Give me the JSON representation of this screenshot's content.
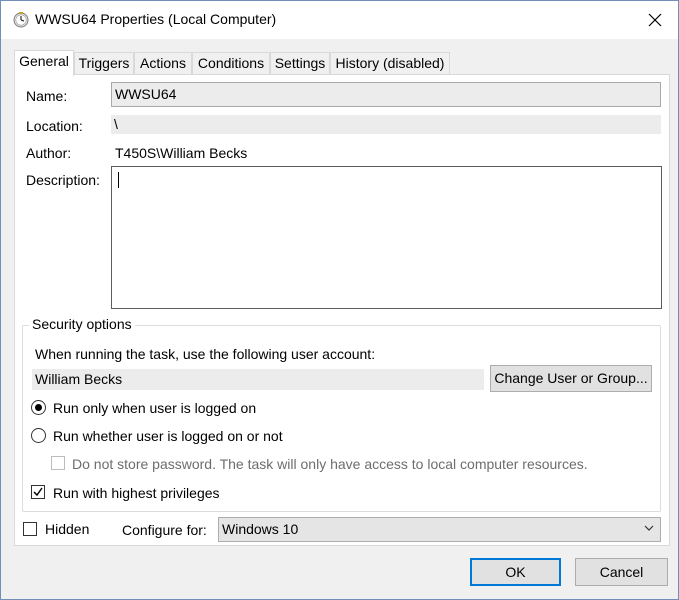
{
  "window": {
    "title": "WWSU64 Properties (Local Computer)"
  },
  "tabs": [
    {
      "label": "General",
      "active": true
    },
    {
      "label": "Triggers",
      "active": false
    },
    {
      "label": "Actions",
      "active": false
    },
    {
      "label": "Conditions",
      "active": false
    },
    {
      "label": "Settings",
      "active": false
    },
    {
      "label": "History (disabled)",
      "active": false
    }
  ],
  "general": {
    "name_label": "Name:",
    "name_value": "WWSU64",
    "location_label": "Location:",
    "location_value": "\\",
    "author_label": "Author:",
    "author_value": "T450S\\William Becks",
    "description_label": "Description:",
    "description_value": ""
  },
  "security": {
    "title": "Security options",
    "account_prompt": "When running the task, use the following user account:",
    "account_value": "William Becks",
    "change_button": "Change User or Group...",
    "radio_logged_on": "Run only when user is logged on",
    "radio_logged_on_checked": true,
    "radio_whether": "Run whether user is logged on or not",
    "radio_whether_checked": false,
    "no_store_password": "Do not store password.  The task will only have access to local computer resources.",
    "no_store_password_checked": false,
    "highest_privileges": "Run with highest privileges",
    "highest_privileges_checked": true
  },
  "footer_options": {
    "hidden_label": "Hidden",
    "hidden_checked": false,
    "configure_label": "Configure for:",
    "configure_value": "Windows 10"
  },
  "buttons": {
    "ok": "OK",
    "cancel": "Cancel"
  },
  "colors": {
    "accent": "#0078d7",
    "window_bg": "#f0f0f0",
    "panel_bg": "#ffffff"
  },
  "icons": {
    "title": "task-scheduler-clock-icon",
    "close": "close-icon",
    "combo": "chevron-down-icon"
  }
}
